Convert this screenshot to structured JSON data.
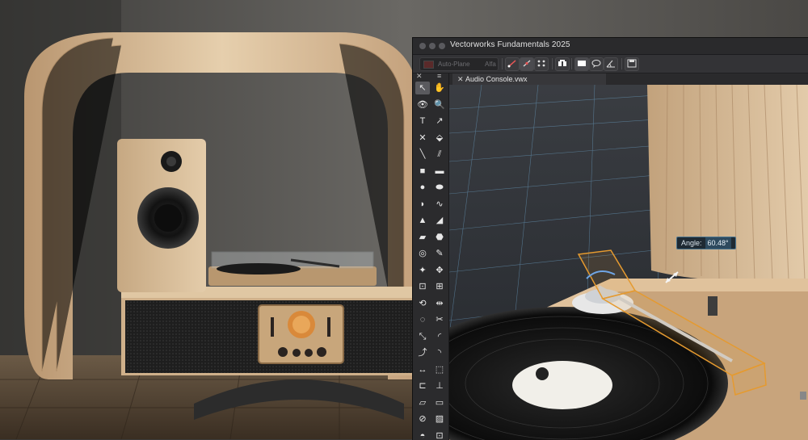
{
  "window": {
    "title": "Vectorworks Fundamentals 2025"
  },
  "toolbar": {
    "plane_label": "Auto-Plane",
    "plane_value": "Alfa",
    "view_buttons": [
      "snap-grid",
      "snap-point",
      "snap-smart",
      "view-3d",
      "render-mode",
      "comment",
      "angle",
      "save-view"
    ]
  },
  "palette": {
    "tools": [
      {
        "name": "selection-tool",
        "glyph": "↖",
        "active": true
      },
      {
        "name": "pan-tool",
        "glyph": "✋"
      },
      {
        "name": "flyover-tool",
        "glyph": "👁"
      },
      {
        "name": "zoom-tool",
        "glyph": "🔍"
      },
      {
        "name": "text-tool",
        "glyph": "T"
      },
      {
        "name": "callout-tool",
        "glyph": "↗"
      },
      {
        "name": "locus-tool",
        "glyph": "✕"
      },
      {
        "name": "push-pull-tool",
        "glyph": "⬙"
      },
      {
        "name": "line-tool",
        "glyph": "╲"
      },
      {
        "name": "double-line-tool",
        "glyph": "⫽"
      },
      {
        "name": "rectangle-tool",
        "glyph": "■"
      },
      {
        "name": "rounded-rect-tool",
        "glyph": "▬"
      },
      {
        "name": "circle-tool",
        "glyph": "●"
      },
      {
        "name": "oval-tool",
        "glyph": "⬬"
      },
      {
        "name": "arc-tool",
        "glyph": "◗"
      },
      {
        "name": "freehand-tool",
        "glyph": "∿"
      },
      {
        "name": "triangle-tool",
        "glyph": "▲"
      },
      {
        "name": "polyline-tool",
        "glyph": "◢"
      },
      {
        "name": "polygon-tool",
        "glyph": "▰"
      },
      {
        "name": "regular-polygon-tool",
        "glyph": "⬣"
      },
      {
        "name": "spiral-tool",
        "glyph": "◎"
      },
      {
        "name": "eyedropper-tool",
        "glyph": "✎"
      },
      {
        "name": "attribute-tool",
        "glyph": "✦"
      },
      {
        "name": "reshape-tool",
        "glyph": "✥"
      },
      {
        "name": "clip-tool",
        "glyph": "⊡"
      },
      {
        "name": "resize-tool",
        "glyph": "⊞"
      },
      {
        "name": "rotate-tool",
        "glyph": "⟲"
      },
      {
        "name": "mirror-tool",
        "glyph": "⇹"
      },
      {
        "name": "offset-tool",
        "glyph": "◌"
      },
      {
        "name": "trim-tool",
        "glyph": "✂"
      },
      {
        "name": "split-tool",
        "glyph": "⤡"
      },
      {
        "name": "fillet-tool",
        "glyph": "◜"
      },
      {
        "name": "connect-tool",
        "glyph": "⤴"
      },
      {
        "name": "chamfer-tool",
        "glyph": "◝"
      },
      {
        "name": "dimension-tool",
        "glyph": "↔"
      },
      {
        "name": "slab-tool",
        "glyph": "⬚"
      },
      {
        "name": "bracket-tool",
        "glyph": "⊏"
      },
      {
        "name": "grid-tool",
        "glyph": "⊥"
      },
      {
        "name": "page-tool",
        "glyph": "▱"
      },
      {
        "name": "layout-tool",
        "glyph": "▭"
      },
      {
        "name": "stop-tool",
        "glyph": "⊘"
      },
      {
        "name": "wall-tool",
        "glyph": "▨"
      },
      {
        "name": "protractor-tool",
        "glyph": "◓"
      },
      {
        "name": "section-tool",
        "glyph": "⊡"
      }
    ]
  },
  "document": {
    "tab_name": "Audio Console.vwx",
    "close_glyph": "✕"
  },
  "angle_readout": {
    "label": "Angle:",
    "value": "60.48°"
  }
}
